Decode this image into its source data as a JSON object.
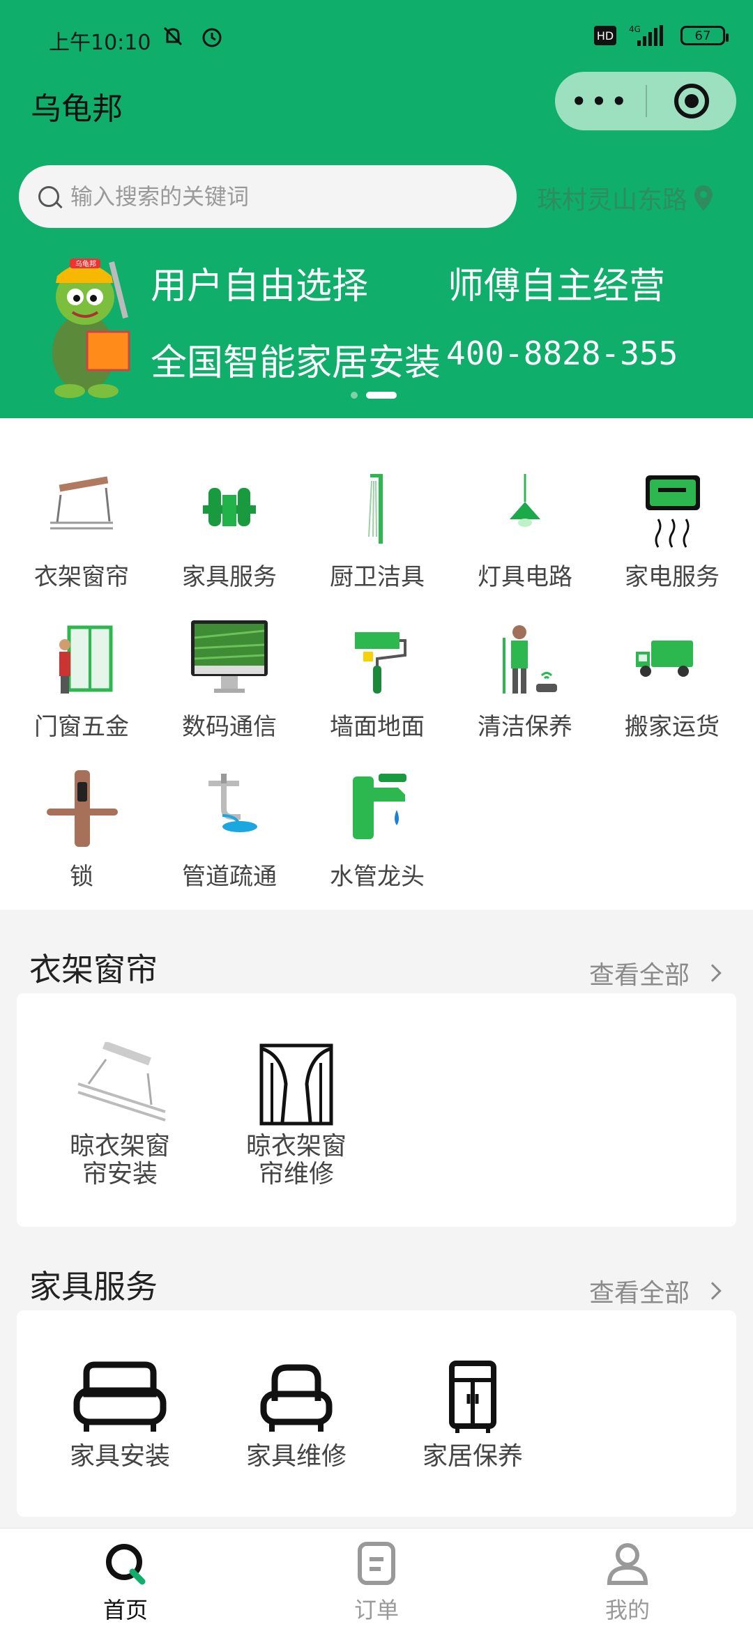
{
  "status_bar": {
    "time": "上午10:10",
    "hd": "HD",
    "network": "4G",
    "battery": "67"
  },
  "header": {
    "title": "乌龟邦",
    "more_label": "•••"
  },
  "search": {
    "placeholder": "输入搜索的关键词",
    "location": "珠村灵山东路"
  },
  "banner": {
    "line1": "用户自由选择",
    "line2": "师傅自主经营",
    "line3": "全国智能家居安装",
    "phone": "400-8828-355",
    "mascot_sign": "乌龟邦"
  },
  "categories": [
    {
      "label": "衣架窗帘",
      "icon": "hanger-rack-icon"
    },
    {
      "label": "家具服务",
      "icon": "furniture-icon"
    },
    {
      "label": "厨卫洁具",
      "icon": "shower-icon"
    },
    {
      "label": "灯具电路",
      "icon": "lamp-icon"
    },
    {
      "label": "家电服务",
      "icon": "air-conditioner-icon"
    },
    {
      "label": "门窗五金",
      "icon": "door-window-icon"
    },
    {
      "label": "数码通信",
      "icon": "monitor-icon"
    },
    {
      "label": "墙面地面",
      "icon": "paint-roller-icon"
    },
    {
      "label": "清洁保养",
      "icon": "cleaning-icon"
    },
    {
      "label": "搬家运货",
      "icon": "truck-icon"
    },
    {
      "label": "锁",
      "icon": "door-lock-icon"
    },
    {
      "label": "管道疏通",
      "icon": "pipe-icon"
    },
    {
      "label": "水管龙头",
      "icon": "faucet-icon"
    }
  ],
  "sections": [
    {
      "title": "衣架窗帘",
      "view_all": "查看全部",
      "items": [
        {
          "line1": "晾衣架窗",
          "line2": "帘安装",
          "icon": "drying-rack-icon"
        },
        {
          "line1": "晾衣架窗",
          "line2": "帘维修",
          "icon": "curtain-icon"
        }
      ]
    },
    {
      "title": "家具服务",
      "view_all": "查看全部",
      "items": [
        {
          "label": "家具安装",
          "icon": "sofa-icon"
        },
        {
          "label": "家具维修",
          "icon": "armchair-icon"
        },
        {
          "label": "家居保养",
          "icon": "cabinet-icon"
        }
      ]
    }
  ],
  "tabbar": [
    {
      "label": "首页",
      "icon": "home-search-icon",
      "active": true
    },
    {
      "label": "订单",
      "icon": "order-icon",
      "active": false
    },
    {
      "label": "我的",
      "icon": "profile-icon",
      "active": false
    }
  ],
  "colors": {
    "brand_green": "#0fae6a",
    "capsule": "#9ce0c0",
    "location_text": "#2e8c5f"
  }
}
